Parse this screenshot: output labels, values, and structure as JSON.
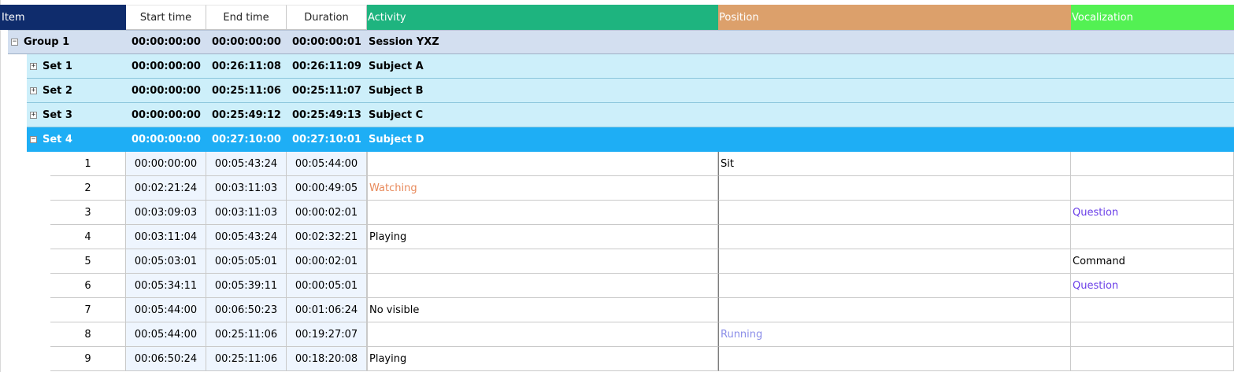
{
  "columns": {
    "item": "Item",
    "start": "Start time",
    "end": "End time",
    "duration": "Duration",
    "activity": "Activity",
    "position": "Position",
    "vocalization": "Vocalization"
  },
  "colors": {
    "header_item": "#0f2c6c",
    "header_activity": "#1eb47f",
    "header_position": "#dca06b",
    "header_vocalization": "#53f153",
    "group_row": "#d3dff0",
    "set_row": "#cdeffa",
    "selected_row": "#1eaef5"
  },
  "groups": [
    {
      "label": "Group  1",
      "start": "00:00:00:00",
      "end": "00:00:00:00",
      "duration": "00:00:00:01",
      "subject": "Session YXZ",
      "toggle": "−",
      "kind": "group"
    },
    {
      "label": "Set  1",
      "start": "00:00:00:00",
      "end": "00:26:11:08",
      "duration": "00:26:11:09",
      "subject": "Subject A",
      "toggle": "+",
      "kind": "set"
    },
    {
      "label": "Set  2",
      "start": "00:00:00:00",
      "end": "00:25:11:06",
      "duration": "00:25:11:07",
      "subject": "Subject B",
      "toggle": "+",
      "kind": "set"
    },
    {
      "label": "Set  3",
      "start": "00:00:00:00",
      "end": "00:25:49:12",
      "duration": "00:25:49:13",
      "subject": "Subject C",
      "toggle": "+",
      "kind": "set"
    },
    {
      "label": "Set  4",
      "start": "00:00:00:00",
      "end": "00:27:10:00",
      "duration": "00:27:10:01",
      "subject": "Subject D",
      "toggle": "−",
      "kind": "selected"
    }
  ],
  "rows": [
    {
      "num": "1",
      "start": "00:00:00:00",
      "end": "00:05:43:24",
      "duration": "00:05:44:00",
      "activity": "",
      "position": "Sit",
      "vocalization": ""
    },
    {
      "num": "2",
      "start": "00:02:21:24",
      "end": "00:03:11:03",
      "duration": "00:00:49:05",
      "activity": "Watching",
      "activity_color": "#e8895a",
      "position": "",
      "vocalization": ""
    },
    {
      "num": "3",
      "start": "00:03:09:03",
      "end": "00:03:11:03",
      "duration": "00:00:02:01",
      "activity": "",
      "position": "",
      "vocalization": "Question",
      "vocalization_color": "#6a3ee8"
    },
    {
      "num": "4",
      "start": "00:03:11:04",
      "end": "00:05:43:24",
      "duration": "00:02:32:21",
      "activity": "Playing",
      "position": "",
      "vocalization": ""
    },
    {
      "num": "5",
      "start": "00:05:03:01",
      "end": "00:05:05:01",
      "duration": "00:00:02:01",
      "activity": "",
      "position": "",
      "vocalization": "Command"
    },
    {
      "num": "6",
      "start": "00:05:34:11",
      "end": "00:05:39:11",
      "duration": "00:00:05:01",
      "activity": "",
      "position": "",
      "vocalization": "Question",
      "vocalization_color": "#6a3ee8"
    },
    {
      "num": "7",
      "start": "00:05:44:00",
      "end": "00:06:50:23",
      "duration": "00:01:06:24",
      "activity": "No visible",
      "position": "",
      "vocalization": ""
    },
    {
      "num": "8",
      "start": "00:05:44:00",
      "end": "00:25:11:06",
      "duration": "00:19:27:07",
      "activity": "",
      "position": "Running",
      "position_color": "#8a8de8",
      "vocalization": ""
    },
    {
      "num": "9",
      "start": "00:06:50:24",
      "end": "00:25:11:06",
      "duration": "00:18:20:08",
      "activity": "Playing",
      "position": "",
      "vocalization": ""
    }
  ]
}
